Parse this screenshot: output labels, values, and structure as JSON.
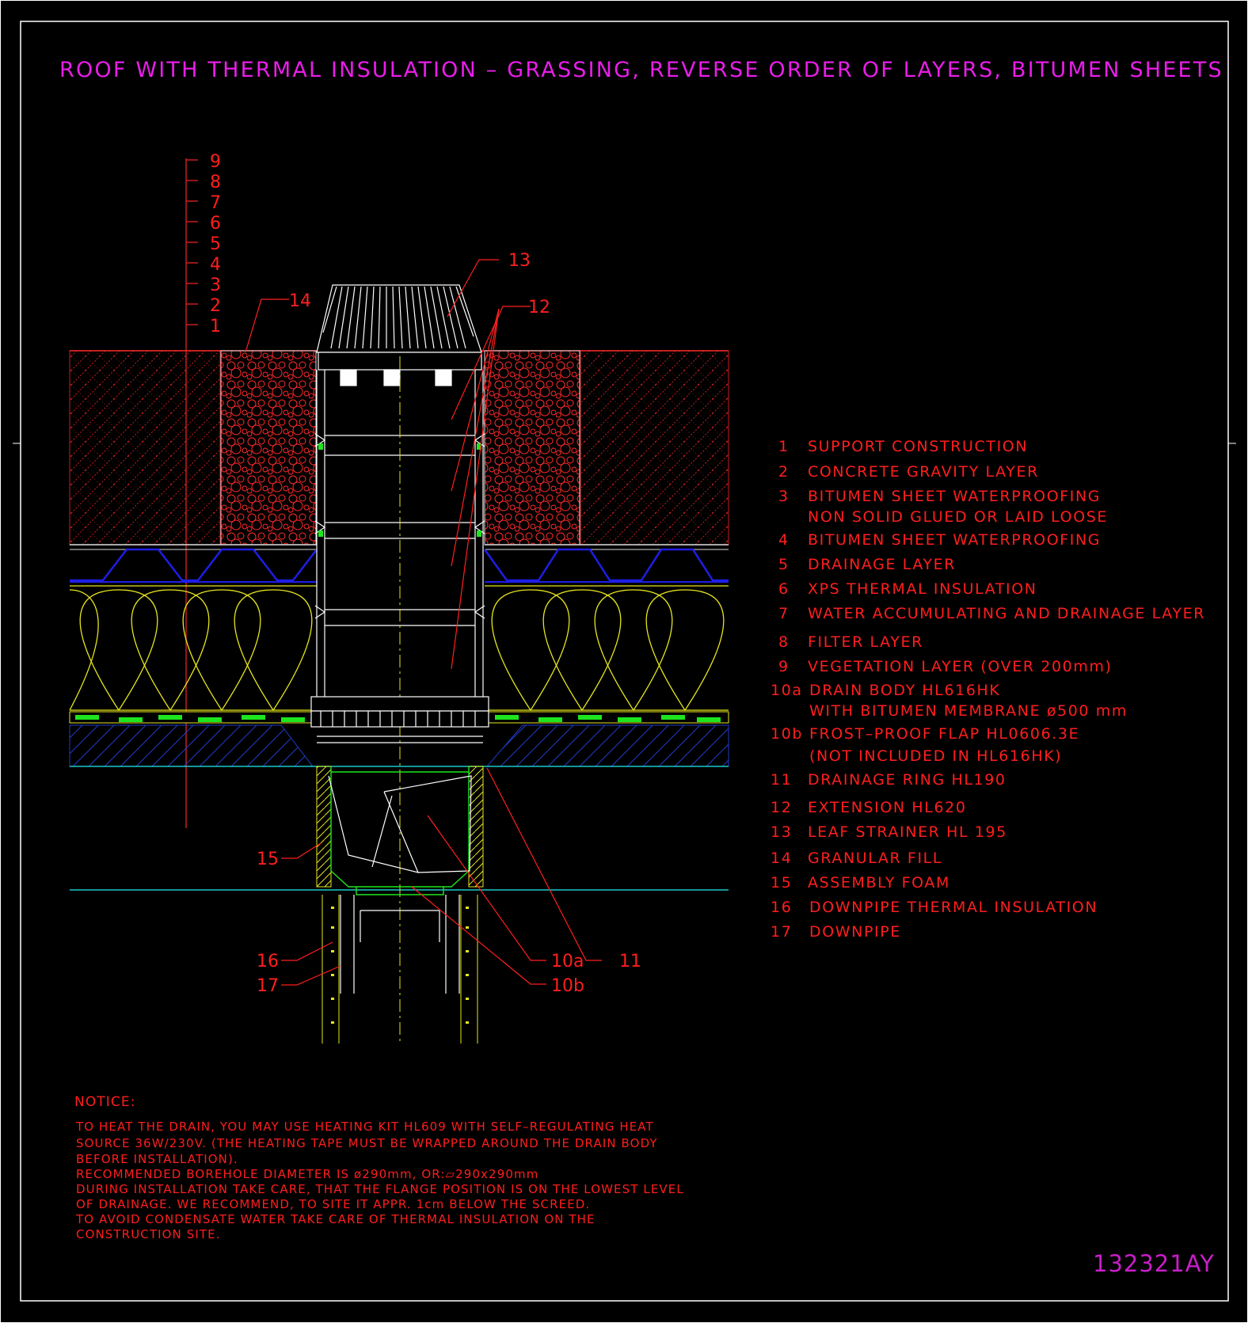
{
  "title": "ROOF WITH THERMAL INSULATION – GRASSING, REVERSE ORDER OF LAYERS, BITUMEN SHEETS",
  "drawing_code": "132321AY",
  "layer_scale": [
    "9",
    "8",
    "7",
    "6",
    "5",
    "4",
    "3",
    "2",
    "1"
  ],
  "callouts": {
    "c13": "13",
    "c12": "12",
    "c14": "14",
    "c15": "15",
    "c16": "16",
    "c17": "17",
    "c10a": "10a",
    "c10b": "10b",
    "c11": "11"
  },
  "legend": [
    {
      "num": "1",
      "lines": [
        "SUPPORT CONSTRUCTION"
      ]
    },
    {
      "num": "2",
      "lines": [
        "CONCRETE GRAVITY LAYER"
      ]
    },
    {
      "num": "3",
      "lines": [
        "BITUMEN SHEET WATERPROOFING",
        "NON SOLID GLUED OR LAID LOOSE"
      ]
    },
    {
      "num": "4",
      "lines": [
        "BITUMEN SHEET WATERPROOFING"
      ]
    },
    {
      "num": "5",
      "lines": [
        "DRAINAGE LAYER"
      ]
    },
    {
      "num": "6",
      "lines": [
        "XPS THERMAL INSULATION"
      ]
    },
    {
      "num": "7",
      "lines": [
        "WATER ACCUMULATING AND DRAINAGE LAYER"
      ]
    },
    {
      "num": "8",
      "lines": [
        "FILTER LAYER"
      ]
    },
    {
      "num": "9",
      "lines": [
        "VEGETATION LAYER (OVER 200mm)"
      ]
    },
    {
      "num": "10a",
      "lines": [
        "DRAIN BODY HL616HK",
        "WITH BITUMEN MEMBRANE ø500 mm"
      ]
    },
    {
      "num": "10b",
      "lines": [
        "FROST–PROOF FLAP HL0606.3E",
        "(NOT INCLUDED IN HL616HK)"
      ]
    },
    {
      "num": "11",
      "lines": [
        "DRAINAGE RING HL190"
      ]
    },
    {
      "num": "12",
      "lines": [
        "EXTENSION HL620"
      ]
    },
    {
      "num": "13",
      "lines": [
        "LEAF STRAINER HL 195"
      ]
    },
    {
      "num": "14",
      "lines": [
        "GRANULAR FILL"
      ]
    },
    {
      "num": "15",
      "lines": [
        "ASSEMBLY FOAM"
      ]
    },
    {
      "num": "16",
      "lines": [
        "DOWNPIPE THERMAL INSULATION"
      ]
    },
    {
      "num": "17",
      "lines": [
        "DOWNPIPE"
      ]
    }
  ],
  "notice": {
    "heading": "NOTICE:",
    "lines": [
      "TO HEAT THE DRAIN, YOU MAY USE HEATING KIT HL609 WITH SELF–REGULATING HEAT",
      "SOURCE 36W/230V. (THE HEATING TAPE MUST BE WRAPPED AROUND THE DRAIN BODY",
      "BEFORE INSTALLATION).",
      "RECOMMENDED BOREHOLE DIAMETER IS ø290mm, OR:▱290x290mm",
      "DURING INSTALLATION TAKE CARE, THAT THE FLANGE POSITION IS ON THE LOWEST LEVEL",
      "OF DRAINAGE. WE RECOMMEND, TO SITE IT APPR. 1cm BELOW THE SCREED.",
      "TO AVOID CONDENSATE WATER TAKE CARE OF THERMAL INSULATION ON THE",
      "CONSTRUCTION SITE."
    ]
  },
  "colors": {
    "background": "#000000",
    "title": "#e81ee8",
    "text": "#ff1e1e",
    "frame": "#ffffff",
    "insulation": "#e6e61e",
    "membrane": "#1e1ee6",
    "filter": "#1ee61e",
    "screed": "#1ec8c8"
  }
}
